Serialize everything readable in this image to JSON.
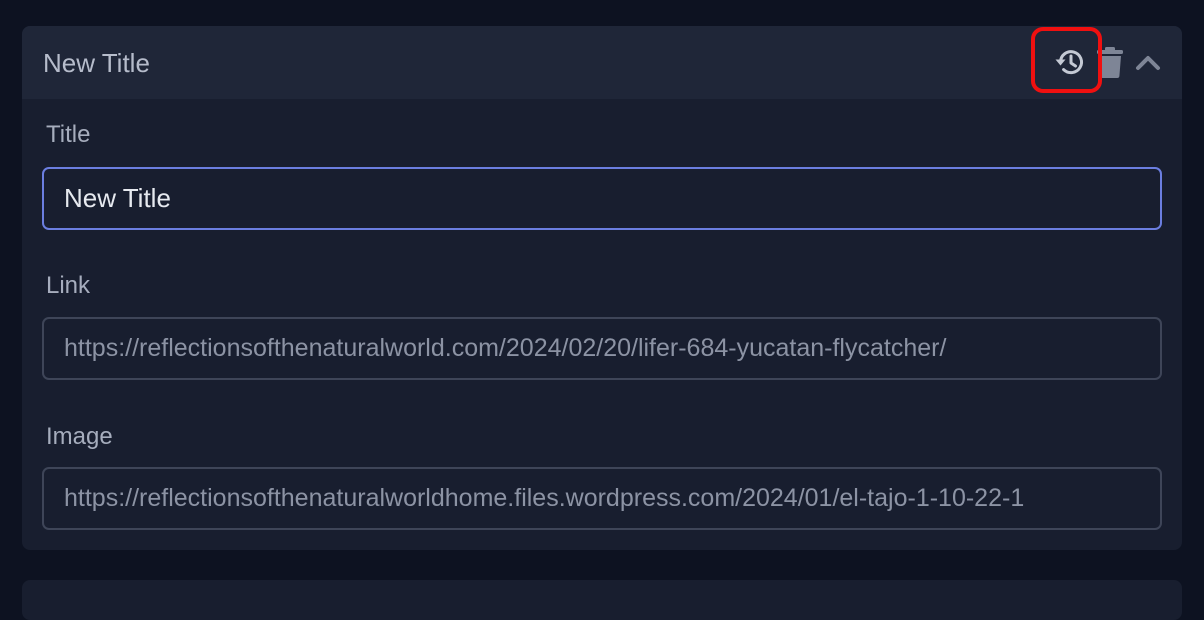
{
  "header": {
    "title": "New Title",
    "icons": [
      "history-icon",
      "trash-icon",
      "chevron-up-icon"
    ],
    "highlight_color": "#f01010"
  },
  "fields": {
    "title": {
      "label": "Title",
      "value": "New Title"
    },
    "link": {
      "label": "Link",
      "value": "https://reflectionsofthenaturalworld.com/2024/02/20/lifer-684-yucatan-flycatcher/"
    },
    "image": {
      "label": "Image",
      "value": "https://reflectionsofthenaturalworldhome.files.wordpress.com/2024/01/el-tajo-1-10-22-1"
    }
  },
  "colors": {
    "background": "#0d1221",
    "panel": "#181e2f",
    "header": "#1f2638",
    "focus_border": "#6b7ee0"
  }
}
